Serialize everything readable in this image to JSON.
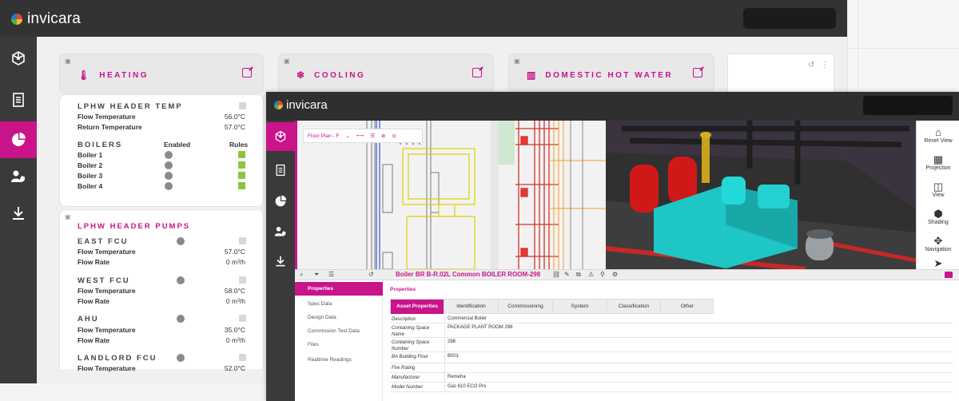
{
  "app": {
    "brand": "invicara"
  },
  "dashboard": {
    "cards": [
      {
        "label": "HEATING",
        "icon": "thermometer-icon"
      },
      {
        "label": "COOLING",
        "icon": "snowflake-icon"
      },
      {
        "label": "DOMESTIC HOT WATER",
        "icon": "radiator-icon"
      }
    ],
    "lphw_header_temp": {
      "title": "LPHW HEADER TEMP",
      "rows": [
        {
          "label": "Flow Temperature",
          "value": "56.0°C"
        },
        {
          "label": "Return Temperature",
          "value": "57.0°C"
        }
      ],
      "boilers_title": "BOILERS",
      "enabled_label": "Enabled",
      "rules_label": "Rules",
      "boilers": [
        "Boiler 1",
        "Boiler 2",
        "Boiler 3",
        "Boiler 4"
      ]
    },
    "lphw_header_pumps": {
      "title": "LPHW HEADER PUMPS",
      "groups": [
        {
          "name": "EAST FCU",
          "rows": [
            {
              "label": "Flow Temperature",
              "value": "57.0°C"
            },
            {
              "label": "Flow Rate",
              "value": "0 m³/h"
            }
          ]
        },
        {
          "name": "WEST FCU",
          "rows": [
            {
              "label": "Flow Temperature",
              "value": "58.0°C"
            },
            {
              "label": "Flow Rate",
              "value": "0 m³/h"
            }
          ]
        },
        {
          "name": "AHU",
          "rows": [
            {
              "label": "Flow Temperature",
              "value": "35.0°C"
            },
            {
              "label": "Flow Rate",
              "value": "0 m³/h"
            }
          ]
        },
        {
          "name": "LANDLORD FCU",
          "rows": [
            {
              "label": "Flow Temperature",
              "value": "52.0°C"
            }
          ]
        }
      ]
    }
  },
  "viewer": {
    "floor_select": "Floor Plan - F",
    "tools": [
      {
        "label": "Reset View",
        "icon": "home-icon"
      },
      {
        "label": "Projection",
        "icon": "grid-icon"
      },
      {
        "label": "View",
        "icon": "camera-icon"
      },
      {
        "label": "Shading",
        "icon": "cube-icon"
      },
      {
        "label": "Navigation",
        "icon": "move-icon"
      }
    ],
    "asset_title": "Boiler BR B-R.02L Common BOILER ROOM-298",
    "nav": [
      "Properties",
      "Spec Data",
      "Design Data",
      "Commission Test Data",
      "Files",
      "Realtime Readings"
    ],
    "properties_label": "Properties",
    "tabs": [
      "Asset Properties",
      "Identification",
      "Commissioning",
      "System",
      "Classification",
      "Other"
    ],
    "rows": [
      {
        "key": "Description",
        "value": "Commercial Boiler"
      },
      {
        "key": "Containing Space Name",
        "value": "PACKAGE PLANT ROOM  298"
      },
      {
        "key": "Containing Space Number",
        "value": "298"
      },
      {
        "key": "BA Building Floor",
        "value": "B001"
      },
      {
        "key": "Fire Rating",
        "value": ""
      },
      {
        "key": "Manufacturer",
        "value": "Remeha"
      },
      {
        "key": "Model Number",
        "value": "Gas 610 ECO Pro"
      }
    ]
  },
  "colors": {
    "accent": "#c9148a",
    "topbar": "#333333",
    "sidebar": "#3a3a3a",
    "enabled_green": "#8cc63f"
  }
}
